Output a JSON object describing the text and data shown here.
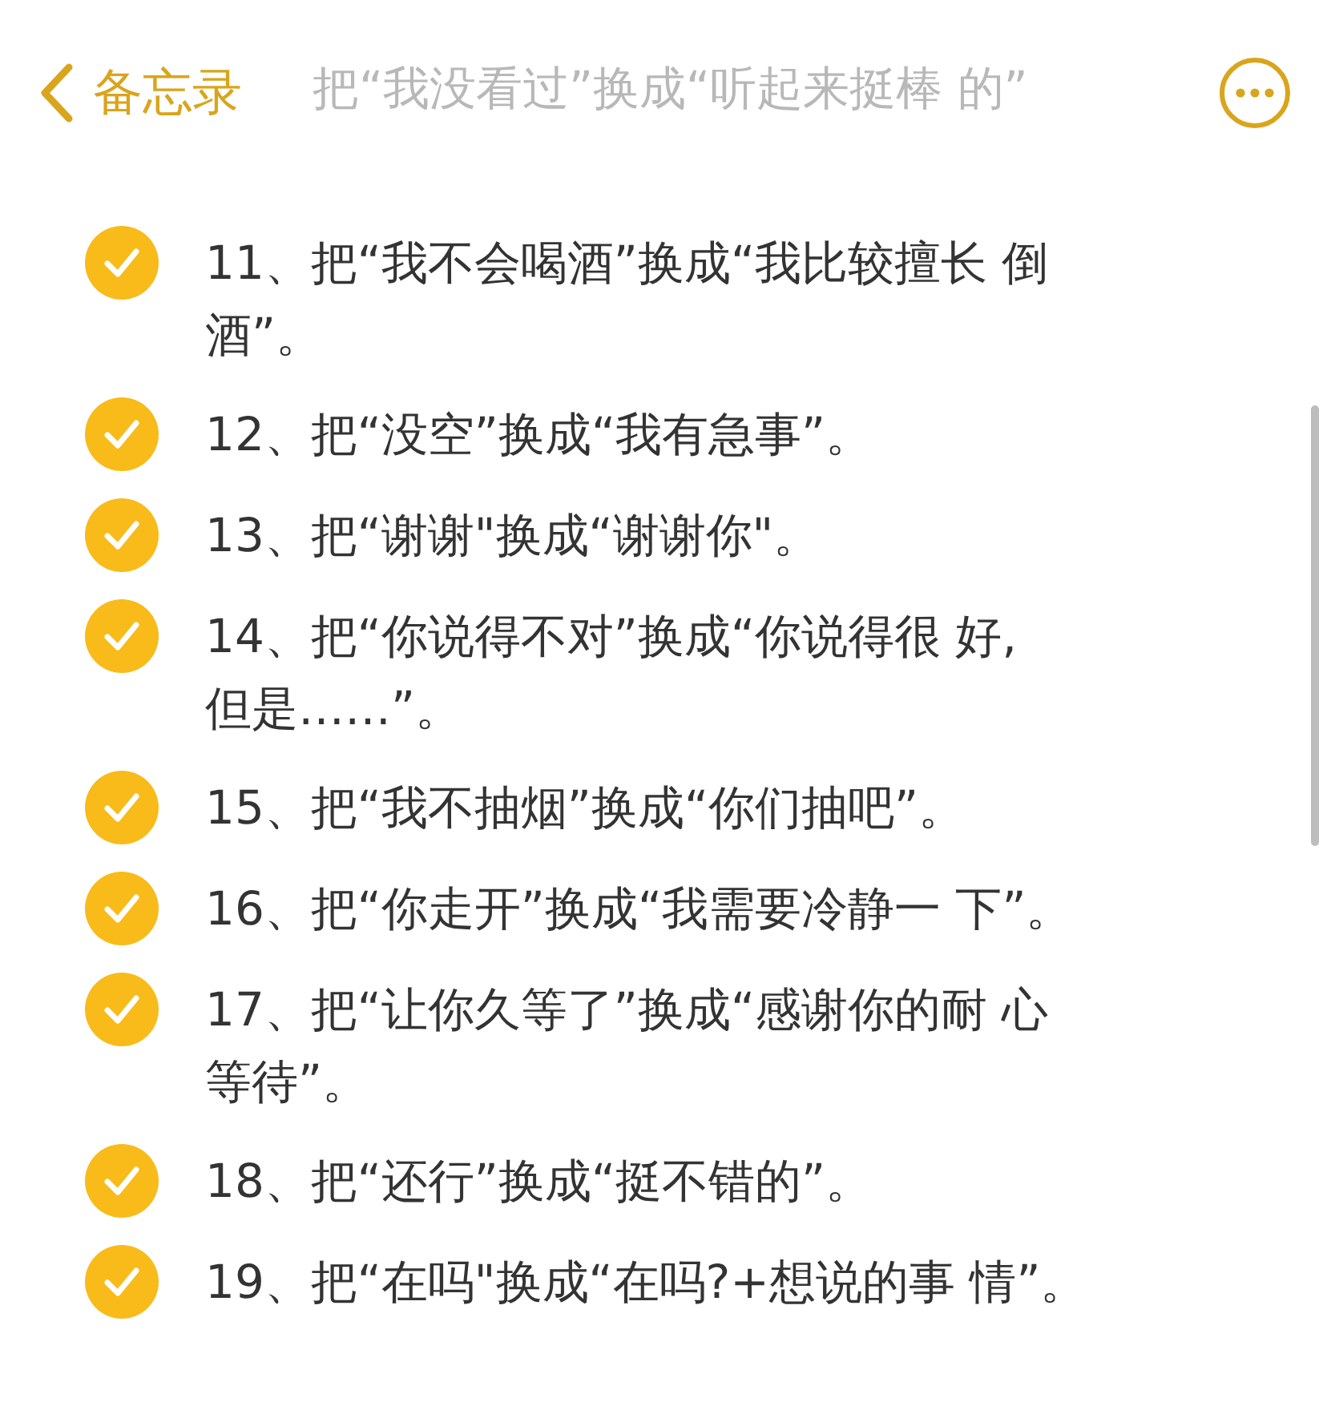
{
  "nav": {
    "back_label": "备忘录",
    "faded_line": "把“我没看过”换成“听起来挺棒 的”"
  },
  "items": [
    {
      "lines": [
        "11、把“我不会喝酒”换成“我比较擅长 倒",
        "酒”。"
      ],
      "checked": true
    },
    {
      "lines": [
        "12、把“没空”换成“我有急事”。"
      ],
      "checked": true
    },
    {
      "lines": [
        "13、把“谢谢\"换成“谢谢你\"。"
      ],
      "checked": true
    },
    {
      "lines": [
        "14、把“你说得不对”换成“你说得很 好,",
        "但是……”。"
      ],
      "checked": true
    },
    {
      "lines": [
        "15、把“我不抽烟”换成“你们抽吧”。"
      ],
      "checked": true
    },
    {
      "lines": [
        "16、把“你走开”换成“我需要冷静一 下”。"
      ],
      "checked": true
    },
    {
      "lines": [
        "17、把“让你久等了”换成“感谢你的耐 心",
        "等待”。"
      ],
      "checked": true
    },
    {
      "lines": [
        "18、把“还行”换成“挺不错的”。"
      ],
      "checked": true
    },
    {
      "lines": [
        "19、把“在吗\"换成“在吗?+想说的事 情”。"
      ],
      "checked": true
    }
  ]
}
